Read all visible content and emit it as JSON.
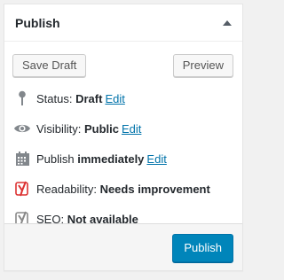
{
  "header": {
    "title": "Publish"
  },
  "actions": {
    "save_draft": "Save Draft",
    "preview": "Preview"
  },
  "rows": {
    "status": {
      "label": "Status:",
      "value": "Draft",
      "edit": "Edit"
    },
    "visibility": {
      "label": "Visibility:",
      "value": "Public",
      "edit": "Edit"
    },
    "schedule": {
      "label": "Publish",
      "value": "immediately",
      "edit": "Edit"
    },
    "readability": {
      "label": "Readability:",
      "value": "Needs improvement"
    },
    "seo": {
      "label": "SEO:",
      "value": "Not available"
    }
  },
  "footer": {
    "publish": "Publish"
  },
  "colors": {
    "accent": "#0085ba",
    "link": "#0073aa",
    "readability_icon": "#dc3232",
    "seo_icon": "#888888"
  }
}
